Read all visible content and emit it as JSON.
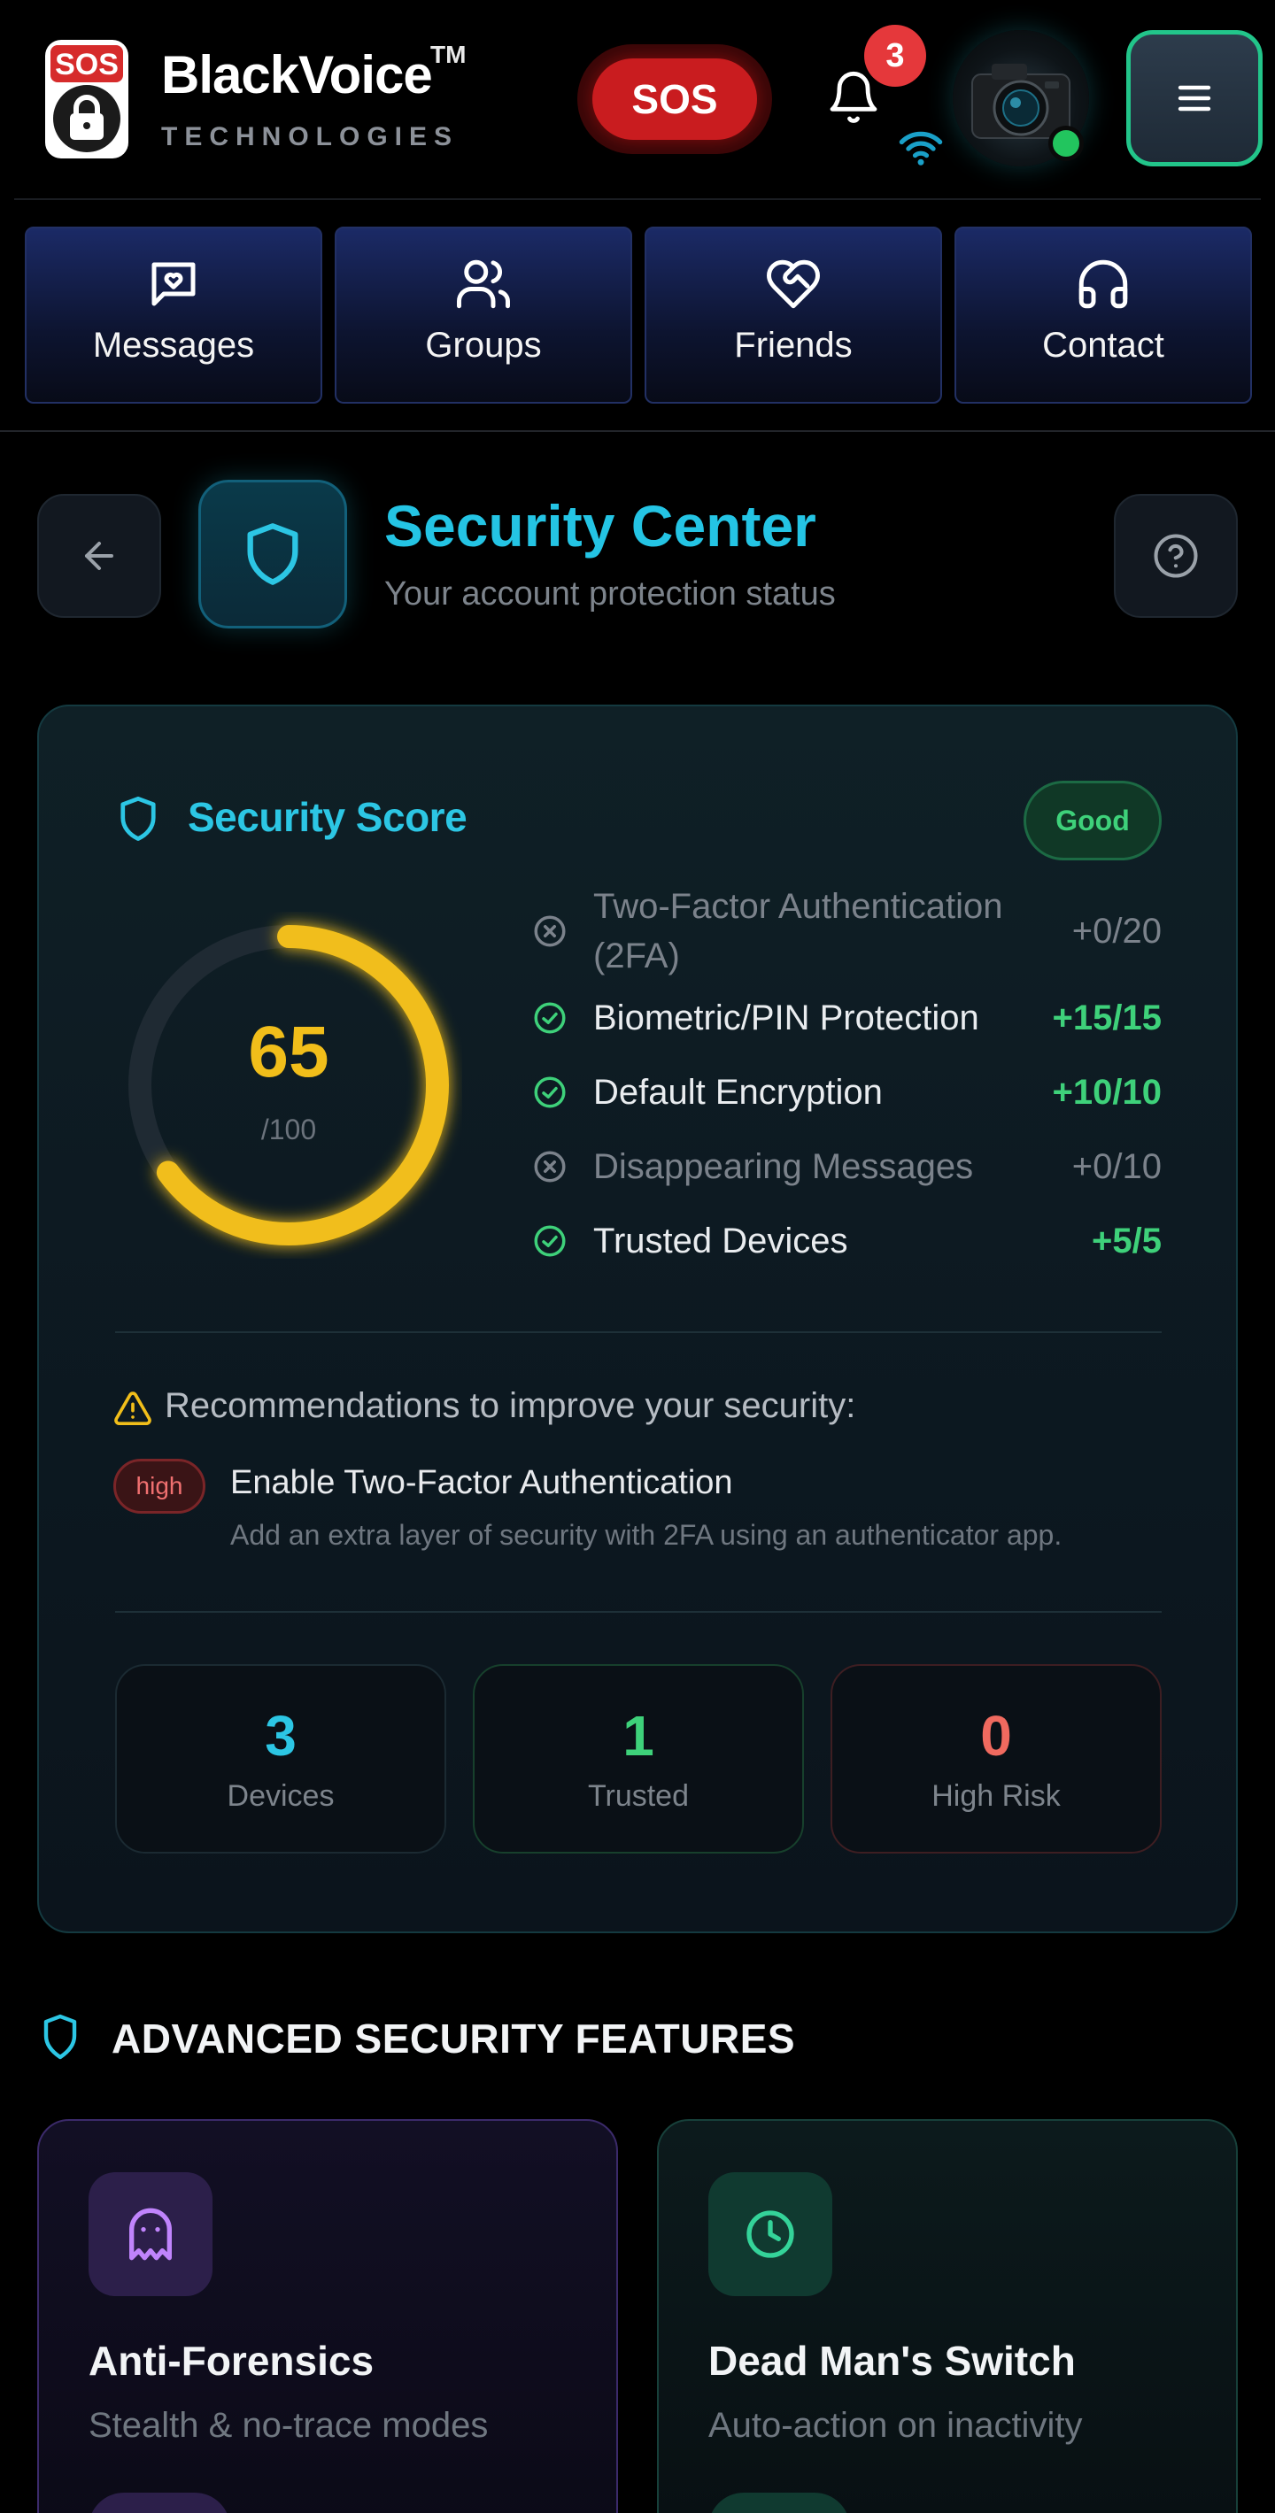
{
  "header": {
    "brand_name": "BlackVoice",
    "brand_tm": "TM",
    "brand_sub": "TECHNOLOGIES",
    "logo_text": "SOS",
    "sos_label": "SOS",
    "notification_count": "3"
  },
  "nav": {
    "tabs": [
      {
        "label": "Messages",
        "icon": "message-heart-icon"
      },
      {
        "label": "Groups",
        "icon": "users-icon"
      },
      {
        "label": "Friends",
        "icon": "heart-handshake-icon"
      },
      {
        "label": "Contact",
        "icon": "headphones-icon"
      }
    ]
  },
  "page": {
    "title": "Security Center",
    "subtitle": "Your account protection status"
  },
  "score": {
    "title": "Security Score",
    "status": "Good",
    "value": "65",
    "max": "/100",
    "fraction": 0.65,
    "checks": [
      {
        "name": "Two-Factor Authentication (2FA)",
        "points": "+0/20",
        "passed": false
      },
      {
        "name": "Biometric/PIN Protection",
        "points": "+15/15",
        "passed": true
      },
      {
        "name": "Default Encryption",
        "points": "+10/10",
        "passed": true
      },
      {
        "name": "Disappearing Messages",
        "points": "+0/10",
        "passed": false
      },
      {
        "name": "Trusted Devices",
        "points": "+5/5",
        "passed": true
      }
    ]
  },
  "recommendations": {
    "title": "Recommendations to improve your security:",
    "items": [
      {
        "priority": "high",
        "title": "Enable Two-Factor Authentication",
        "description": "Add an extra layer of security with 2FA using an authenticator app."
      }
    ]
  },
  "stats": [
    {
      "value": "3",
      "label": "Devices",
      "color": "#2cc6e4"
    },
    {
      "value": "1",
      "label": "Trusted",
      "color": "#3ed17a"
    },
    {
      "value": "0",
      "label": "High Risk",
      "color": "#f06a5f"
    }
  ],
  "advanced": {
    "title": "ADVANCED SECURITY FEATURES",
    "features": [
      {
        "title": "Anti-Forensics",
        "subtitle": "Stealth & no-trace modes",
        "icon": "ghost-icon",
        "color": "#c084fc"
      },
      {
        "title": "Dead Man's Switch",
        "subtitle": "Auto-action on inactivity",
        "icon": "clock-icon",
        "color": "#34d399"
      }
    ]
  },
  "colors": {
    "accent_cyan": "#24c4e4",
    "gauge_yellow": "#f1be1a",
    "success_green": "#3ed17a",
    "danger_red": "#c91c1f"
  }
}
